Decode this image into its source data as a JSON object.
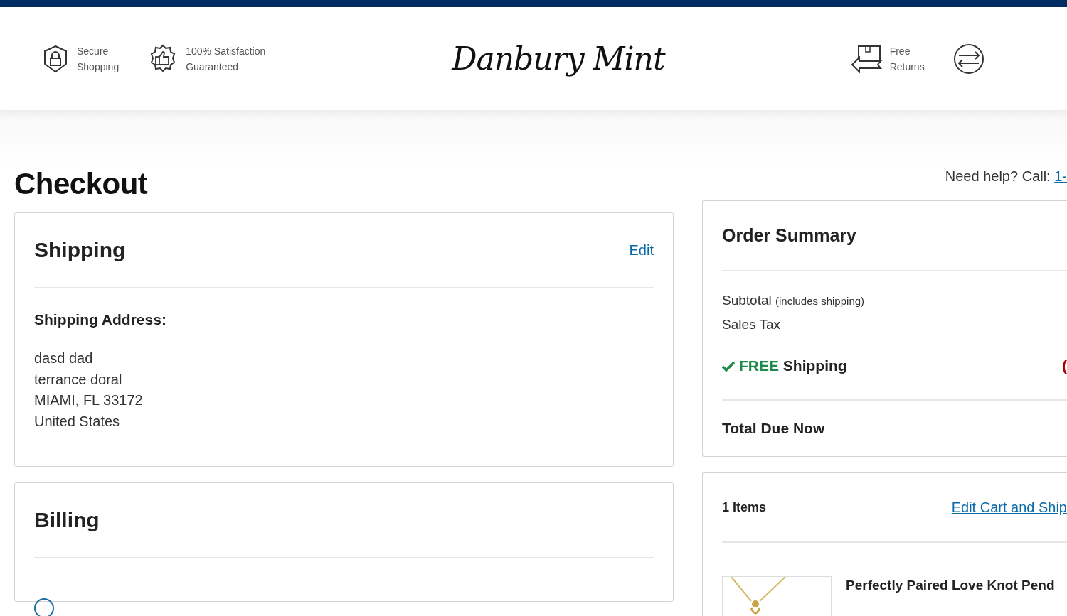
{
  "header": {
    "badges_left": [
      {
        "kind": "lock",
        "lines": [
          "Secure",
          "Shopping"
        ]
      },
      {
        "kind": "thumb",
        "lines": [
          "100% Satisfaction",
          "Guaranteed"
        ]
      }
    ],
    "logo": "Danbury Mint",
    "badges_right": [
      {
        "kind": "returns",
        "lines": [
          "Free",
          "Returns"
        ]
      },
      {
        "kind": "exchange"
      }
    ]
  },
  "page_title": "Checkout",
  "help": {
    "text": "Need help? Call:",
    "link": "1-"
  },
  "shipping": {
    "title": "Shipping",
    "edit": "Edit",
    "address_label": "Shipping Address:",
    "address_lines": [
      "dasd dad",
      "terrance doral",
      "MIAMI, FL 33172",
      "United States"
    ]
  },
  "billing": {
    "title": "Billing",
    "radio_selected": false
  },
  "order_summary": {
    "title": "Order Summary",
    "subtotal_label": "Subtotal",
    "subtotal_note": "(includes shipping)",
    "tax_label": "Sales Tax",
    "free_label": "FREE",
    "shipping_label": "Shipping",
    "shipping_value": "(",
    "total_label": "Total Due Now"
  },
  "items": {
    "count": "1 Items",
    "edit_link": "Edit Cart and Ship",
    "products": [
      {
        "kind": "picture",
        "name": "Perfectly Paired Love Knot Pend"
      }
    ]
  }
}
